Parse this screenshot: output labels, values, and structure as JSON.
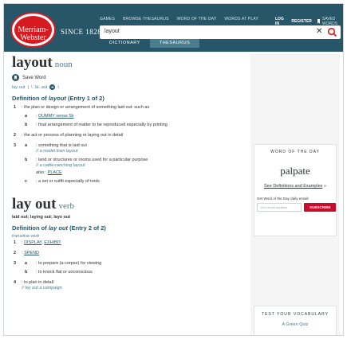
{
  "header": {
    "logo_line1": "Merriam-",
    "logo_line2": "Webster",
    "since": "SINCE 1828",
    "nav": [
      "GAMES",
      "BROWSE THESAURUS",
      "WORD OF THE DAY",
      "WORDS AT PLAY"
    ],
    "login": "LOG IN",
    "register": "REGISTER",
    "saved": "SAVED WORDS",
    "search_value": "layout",
    "clear_glyph": "✕",
    "tab_dictionary": "DICTIONARY",
    "tab_thesaurus": "THESAURUS",
    "colors": {
      "header_bg": "#265667",
      "logo_red": "#d71920"
    }
  },
  "entry1": {
    "headword": "layout",
    "pos": "noun",
    "save_word": "Save Word",
    "pron_pre": "lay·out",
    "pron_sep": "|",
    "pron": "\\ ˈlā-ˌau̇t",
    "pron_end": "\\",
    "def_heading_pre": "Definition of ",
    "def_heading_word": "layout",
    "def_heading_post": " (Entry 1 of 2)",
    "s1_num": "1",
    "s1_text": ": the plan or design or arrangement of something laid out: such as",
    "s1a_let": "a",
    "s1a_colon": ":",
    "s1a_link": "DUMMY sense 5b",
    "s1b_let": "b",
    "s1b_text": ": final arrangement of matter to be reproduced especially by printing",
    "s2_num": "2",
    "s2_text": ": the act or process of planning or laying out in detail",
    "s3_num": "3",
    "s3a_let": "a",
    "s3a_text": ": something that is laid out",
    "s3a_ex": "// a model train layout",
    "s3b_let": "b",
    "s3b_text": ": land or structures or rooms used for a particular purpose",
    "s3b_ex": "// a cattle-ranching layout",
    "s3b_also": "also :",
    "s3b_also_link": "PLACE",
    "s3c_let": "c",
    "s3c_text": ": a set or outfit especially of tools"
  },
  "entry2": {
    "headword": "lay out",
    "pos": "verb",
    "forms": "laid out; laying out; lays out",
    "def_heading_pre": "Definition of ",
    "def_heading_word": "lay out",
    "def_heading_post": " (Entry 2 of 2)",
    "trans": "transitive verb",
    "s1_num": "1",
    "s1_colon": ":",
    "s1_link1": "DISPLAY",
    "s1_comma": ",",
    "s1_link2": "EXHIBIT",
    "s2_num": "2",
    "s2_colon": ":",
    "s2_link": "SPEND",
    "s3_num": "3",
    "s3a_let": "a",
    "s3a_text": ": to prepare (a corpse) for viewing",
    "s3b_let": "b",
    "s3b_text": ": to knock flat or unconscious",
    "s4_num": "4",
    "s4_text": ": to plan in detail",
    "s4_ex": "// lay out a campaign"
  },
  "rail": {
    "wotd_title": "WORD OF THE DAY",
    "wotd_word": "palpate",
    "wotd_link": "See Definitions and Examples",
    "wotd_link_arrow": "»",
    "email_prompt": "Get Word of the Day daily email!",
    "email_placeholder": "Your email address",
    "subscribe": "SUBSCRIBE",
    "vocab_title": "TEST YOUR VOCABULARY",
    "vocab_sub": "A Green Quiz",
    "colors": {
      "subscribe_bg": "#c70c2c"
    }
  }
}
